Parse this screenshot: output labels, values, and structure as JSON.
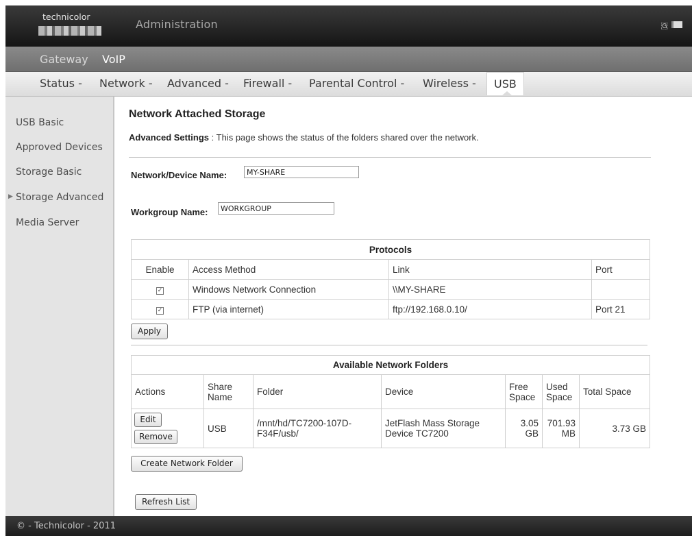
{
  "header": {
    "logo_text": "technicolor",
    "title": "Administration",
    "lang_icon": "flag-icon",
    "screen_icon": "screen-icon"
  },
  "nav1": {
    "items": [
      "Gateway",
      "VoIP"
    ]
  },
  "nav2": {
    "items": [
      "Status -",
      "Network -",
      "Advanced -",
      "Firewall -",
      "Parental Control -",
      "Wireless -",
      "USB"
    ]
  },
  "sidebar": {
    "items": [
      "USB Basic",
      "Approved Devices",
      "Storage Basic",
      "Storage Advanced",
      "Media Server"
    ],
    "active_index": 3
  },
  "main": {
    "title": "Network Attached Storage",
    "intro_bold": "Advanced Settings",
    "intro_text": ": This page shows the status of the folders shared over the network.",
    "device_name_label": "Network/Device Name:",
    "device_name_value": "MY-SHARE",
    "workgroup_label": "Workgroup Name:",
    "workgroup_value": "WORKGROUP"
  },
  "protocols": {
    "title": "Protocols",
    "headers": [
      "Enable",
      "Access Method",
      "Link",
      "Port"
    ],
    "rows": [
      {
        "enabled": true,
        "access_method": "Windows Network Connection",
        "link": "\\\\MY-SHARE",
        "port": ""
      },
      {
        "enabled": true,
        "access_method": "FTP (via internet)",
        "link": "ftp://192.168.0.10/",
        "port": "Port 21"
      }
    ],
    "apply_label": "Apply"
  },
  "folders": {
    "title": "Available Network Folders",
    "headers": [
      "Actions",
      "Share Name",
      "Folder",
      "Device",
      "Free Space",
      "Used Space",
      "Total Space"
    ],
    "rows": [
      {
        "edit_label": "Edit",
        "remove_label": "Remove",
        "share_name": "USB",
        "folder": "/mnt/hd/TC7200-107D-F34F/usb/",
        "device": "JetFlash Mass Storage Device TC7200",
        "free": "3.05 GB",
        "used": "701.93 MB",
        "total": "3.73 GB"
      }
    ],
    "create_label": "Create Network Folder",
    "refresh_label": "Refresh List"
  },
  "footer": {
    "text": "© - Technicolor - 2011"
  }
}
